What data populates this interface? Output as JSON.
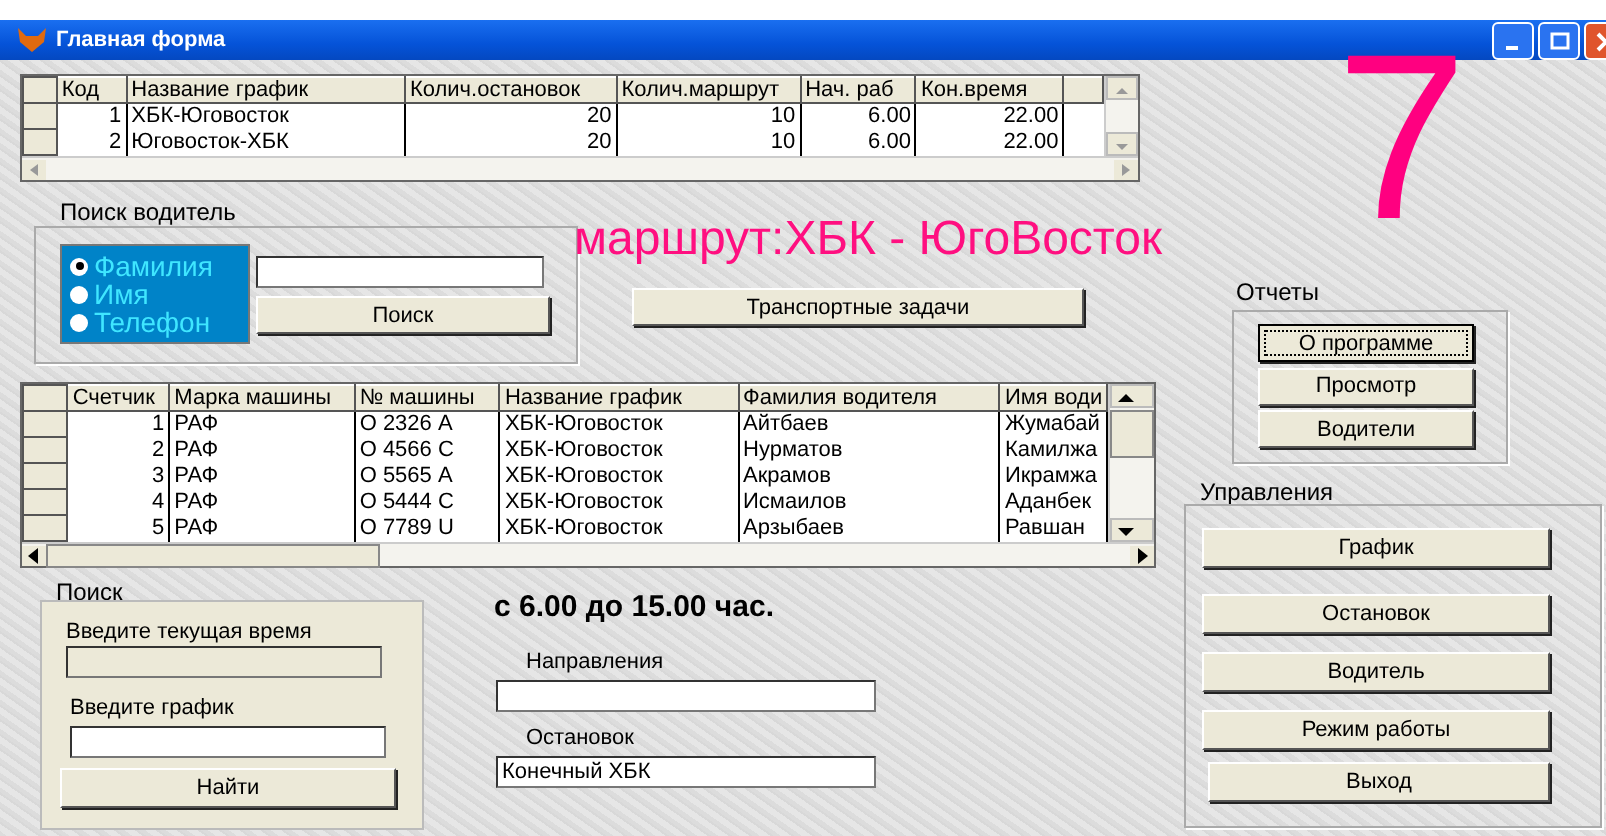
{
  "window": {
    "title": "Главная форма"
  },
  "routes_table": {
    "columns": [
      {
        "label": "Код",
        "numeric": true
      },
      {
        "label": "Название график",
        "numeric": false
      },
      {
        "label": "Колич.остановок",
        "numeric": true
      },
      {
        "label": "Колич.маршрут",
        "numeric": true
      },
      {
        "label": "Нач. раб",
        "numeric": true
      },
      {
        "label": "Кон.время",
        "numeric": true
      }
    ],
    "rows": [
      [
        "1",
        "ХБК-Юговосток",
        "20",
        "10",
        "6.00",
        "22.00"
      ],
      [
        "2",
        "Юговосток-ХБК",
        "20",
        "10",
        "6.00",
        "22.00"
      ]
    ]
  },
  "driver_search": {
    "label": "Поиск водитель",
    "options": [
      {
        "label": "Фамилия",
        "selected": true
      },
      {
        "label": "Имя",
        "selected": false
      },
      {
        "label": "Телефон",
        "selected": false
      }
    ],
    "button": "Поиск"
  },
  "route_banner": "маршрут:ХБК - ЮгоВосток",
  "big_number": "7",
  "transport_button": "Транспортные задачи",
  "reports": {
    "label": "Отчеты",
    "buttons": [
      {
        "label": "О программе",
        "focused": true
      },
      {
        "label": "Просмотр",
        "focused": false
      },
      {
        "label": "Водители",
        "focused": false
      }
    ]
  },
  "cars_table": {
    "columns": [
      {
        "label": "Счетчик",
        "numeric": true
      },
      {
        "label": "Марка машины",
        "numeric": false
      },
      {
        "label": "№ машины",
        "numeric": false
      },
      {
        "label": "Название график",
        "numeric": false
      },
      {
        "label": "Фамилия водителя",
        "numeric": false
      },
      {
        "label": "Имя води",
        "numeric": false
      }
    ],
    "rows": [
      [
        "1",
        "РАФ",
        "О 2326 А",
        "ХБК-Юговосток",
        "Айтбаев",
        "Жумабай"
      ],
      [
        "2",
        "РАФ",
        "О 4566 С",
        "ХБК-Юговосток",
        "Нурматов",
        "Камилжа"
      ],
      [
        "3",
        "РАФ",
        "О 5565 А",
        "ХБК-Юговосток",
        "Акрамов",
        "Икрамжа"
      ],
      [
        "4",
        "РАФ",
        "О 5444 С",
        "ХБК-Юговосток",
        "Исмаилов",
        "Аданбек"
      ],
      [
        "5",
        "РАФ",
        "О 7789 U",
        "ХБК-Юговосток",
        "Арзыбаев",
        "Равшан"
      ]
    ]
  },
  "management": {
    "label": "Управления",
    "buttons": [
      "График",
      "Остановок",
      "Водитель",
      "Режим работы",
      "Выход"
    ]
  },
  "search": {
    "label": "Поиск",
    "fields": [
      {
        "label": "Введите текущая время",
        "disabled": true
      },
      {
        "label": "Введите график",
        "disabled": false
      }
    ],
    "button": "Найти"
  },
  "hours": "с 6.00 до 15.00 час.",
  "route_fields": [
    {
      "label": "Направления"
    },
    {
      "label": "Остановок",
      "value": "Конечный ХБК"
    }
  ]
}
